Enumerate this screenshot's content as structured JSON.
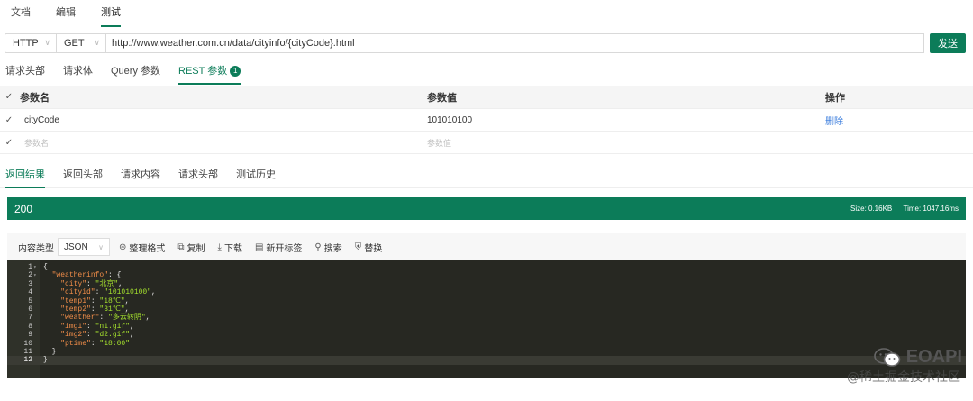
{
  "top_tabs": [
    "文档",
    "编辑",
    "测试"
  ],
  "request": {
    "protocol": "HTTP",
    "method": "GET",
    "url": "http://www.weather.com.cn/data/cityinfo/{cityCode}.html",
    "send_label": "发送"
  },
  "request_tabs": {
    "headers": "请求头部",
    "body": "请求体",
    "query": "Query 参数",
    "rest": "REST 参数",
    "rest_badge": "1"
  },
  "params_table": {
    "col_name": "参数名",
    "col_value": "参数值",
    "col_action": "操作",
    "rows": [
      {
        "name": "cityCode",
        "value": "101010100",
        "action": "删除"
      }
    ],
    "placeholder_name": "参数名",
    "placeholder_value": "参数值"
  },
  "response_tabs": [
    "返回结果",
    "返回头部",
    "请求内容",
    "请求头部",
    "测试历史"
  ],
  "status": {
    "code": "200",
    "size": "Size: 0.16KB",
    "time": "Time: 1047.16ms",
    "color": "#0c7c59"
  },
  "toolbar": {
    "format_label": "内容类型",
    "format_value": "JSON",
    "beautify": "整理格式",
    "copy": "复制",
    "download": "下载",
    "new_tab": "新开标签",
    "search": "搜索",
    "replace": "替换"
  },
  "code_lines": [
    "{",
    "  \"weatherinfo\": {",
    "    \"city\": \"北京\",",
    "    \"cityid\": \"101010100\",",
    "    \"temp1\": \"18℃\",",
    "    \"temp2\": \"31℃\",",
    "    \"weather\": \"多云转阴\",",
    "    \"img1\": \"n1.gif\",",
    "    \"img2\": \"d2.gif\",",
    "    \"ptime\": \"18:00\"",
    "  }",
    "}"
  ],
  "watermark": {
    "brand": "EOAPI",
    "sub": "@稀土掘金技术社区"
  }
}
